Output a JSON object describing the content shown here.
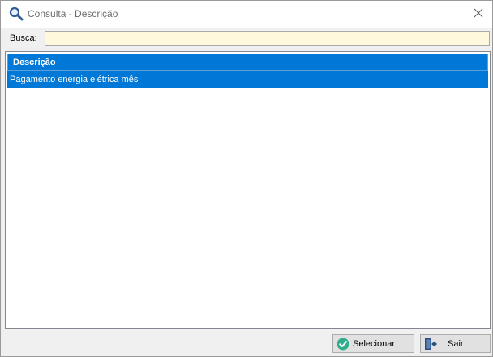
{
  "window": {
    "title": "Consulta - Descrição",
    "title_icon": "search-icon",
    "close_icon": "close-icon"
  },
  "search": {
    "label": "Busca:",
    "value": "",
    "placeholder": ""
  },
  "grid": {
    "columns": [
      "Descrição"
    ],
    "rows": [
      {
        "descricao": "Pagamento energia elétrica mês",
        "selected": true
      }
    ]
  },
  "buttons": {
    "select_label": "Selecionar",
    "select_icon": "check-circle-icon",
    "exit_label": "Sair",
    "exit_icon": "exit-door-icon"
  },
  "colors": {
    "selection": "#0078d7",
    "search_input_bg": "#fff8dd",
    "check_icon": "#2fae8c",
    "exit_icon": "#2b4f7e"
  }
}
